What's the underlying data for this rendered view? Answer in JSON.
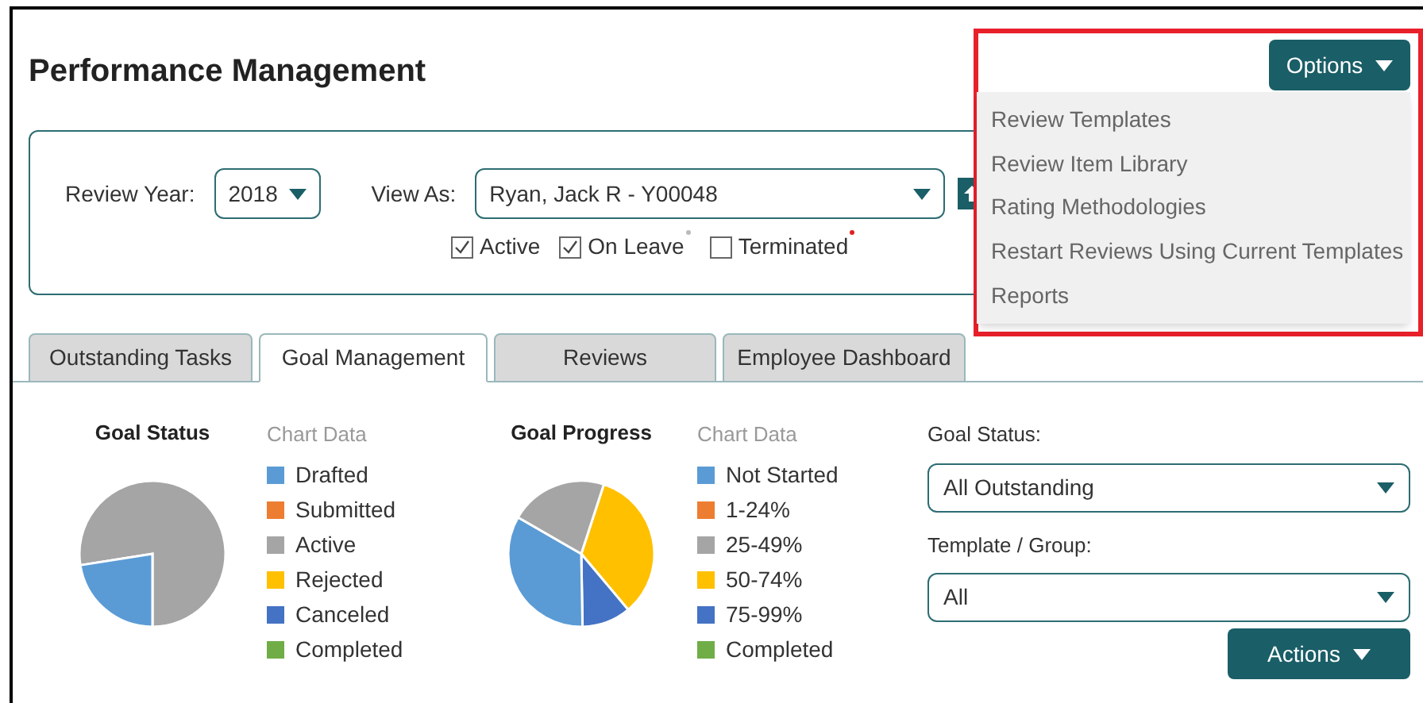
{
  "page_title": "Performance Management",
  "filters": {
    "review_year": {
      "label": "Review Year:",
      "value": "2018"
    },
    "view_as": {
      "label": "View As:",
      "value": "Ryan, Jack R - Y00048"
    },
    "checkboxes": [
      {
        "label": "Active",
        "checked": true
      },
      {
        "label": "On Leave",
        "checked": true,
        "color": "#bbbbbb"
      },
      {
        "label": "Terminated",
        "checked": false,
        "color": "#e02020"
      }
    ]
  },
  "tabs": [
    {
      "label": "Outstanding Tasks",
      "selected": false
    },
    {
      "label": "Goal Management",
      "selected": true
    },
    {
      "label": "Reviews",
      "selected": false
    },
    {
      "label": "Employee Dashboard",
      "selected": false
    }
  ],
  "charts": [
    {
      "title": "Goal Status",
      "legend_title": "Chart Data",
      "legend": [
        {
          "label": "Drafted",
          "color": "#5b9bd5"
        },
        {
          "label": "Submitted",
          "color": "#ed7d31"
        },
        {
          "label": "Active",
          "color": "#a5a5a5"
        },
        {
          "label": "Rejected",
          "color": "#ffc000"
        },
        {
          "label": "Canceled",
          "color": "#4472c4"
        },
        {
          "label": "Completed",
          "color": "#70ad47"
        }
      ]
    },
    {
      "title": "Goal Progress",
      "legend_title": "Chart Data",
      "legend": [
        {
          "label": "Not Started",
          "color": "#5b9bd5"
        },
        {
          "label": "1-24%",
          "color": "#ed7d31"
        },
        {
          "label": "25-49%",
          "color": "#a5a5a5"
        },
        {
          "label": "50-74%",
          "color": "#ffc000"
        },
        {
          "label": "75-99%",
          "color": "#4472c4"
        },
        {
          "label": "Completed",
          "color": "#70ad47"
        }
      ]
    }
  ],
  "goal_filters": [
    {
      "label": "Goal Status:",
      "value": "All Outstanding"
    },
    {
      "label": "Template / Group:",
      "value": "All"
    }
  ],
  "actions_button": "Actions",
  "options_menu": {
    "button": "Options",
    "highlighted": true,
    "items": [
      "Review Templates",
      "Review Item Library",
      "Rating Methodologies",
      "Restart Reviews Using Current Templates",
      "Reports"
    ]
  }
}
